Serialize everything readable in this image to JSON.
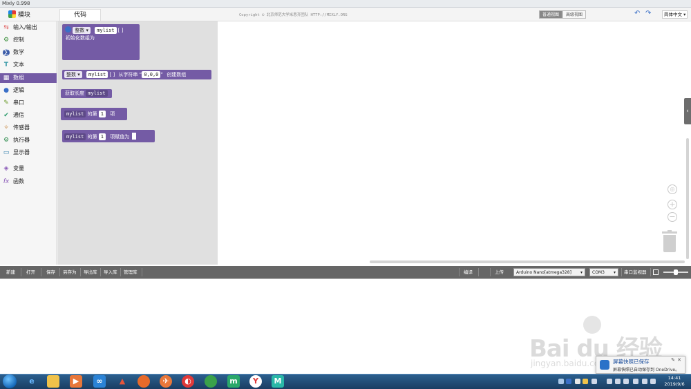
{
  "window": {
    "title": "Mixly 0.998"
  },
  "header": {
    "modules_title": "模块",
    "code_tab": "代码",
    "copyright": "Copyright © 北京师范大学米思齐团队 HTTP://MIXLY.ORG",
    "view_simple": "普通视图",
    "view_advanced": "高级视图",
    "language": "简体中文"
  },
  "sidebar": {
    "items": [
      {
        "label": "输入/输出",
        "icon": "io-icon"
      },
      {
        "label": "控制",
        "icon": "control-icon"
      },
      {
        "label": "数学",
        "icon": "math-icon"
      },
      {
        "label": "文本",
        "icon": "text-icon"
      },
      {
        "label": "数组",
        "icon": "array-icon"
      },
      {
        "label": "逻辑",
        "icon": "logic-icon"
      },
      {
        "label": "串口",
        "icon": "serial-icon"
      },
      {
        "label": "通信",
        "icon": "comm-icon"
      },
      {
        "label": "传感器",
        "icon": "sensor-icon"
      },
      {
        "label": "执行器",
        "icon": "actuator-icon"
      },
      {
        "label": "显示器",
        "icon": "display-icon"
      },
      {
        "label": "变量",
        "icon": "variable-icon"
      },
      {
        "label": "函数",
        "icon": "function-icon"
      }
    ],
    "active_index": 4
  },
  "flyout": {
    "block1": {
      "type": "整数",
      "var": "mylist",
      "brackets": "[ ]",
      "label": "初始化数组为"
    },
    "block2": {
      "type": "整数",
      "var": "mylist",
      "brackets": "[ ]",
      "from_string": "从字符串",
      "quote_open": "“",
      "value": "0,0,0",
      "quote_close": "”",
      "create": "创建数组"
    },
    "block3": {
      "label": "获取长度",
      "var": "mylist"
    },
    "block4": {
      "var": "mylist",
      "of": "的第",
      "index": "1",
      "item": "项"
    },
    "block5": {
      "var": "mylist",
      "of": "的第",
      "index": "1",
      "assign": "项赋值为"
    }
  },
  "toolbar": {
    "new": "新建",
    "open": "打开",
    "save": "保存",
    "save_as": "另存为",
    "export": "导出库",
    "import": "导入库",
    "manage": "管理库",
    "compile": "编译",
    "upload": "上传",
    "board": "Arduino Nano[atmega328]",
    "port": "COM3",
    "serial_monitor": "串口监视器"
  },
  "watermark": {
    "text": "Bai du 经验",
    "url": "jingyan.baidu.com"
  },
  "notification": {
    "title": "屏幕快照已保存",
    "body": "屏幕快照已自动保存到 OneDrive。"
  },
  "taskbar": {
    "time": "14:41",
    "date": "2019/9/6"
  },
  "colors": {
    "accent": "#745ba5",
    "toolbar": "#666666",
    "flyout": "#e0e0e0"
  }
}
